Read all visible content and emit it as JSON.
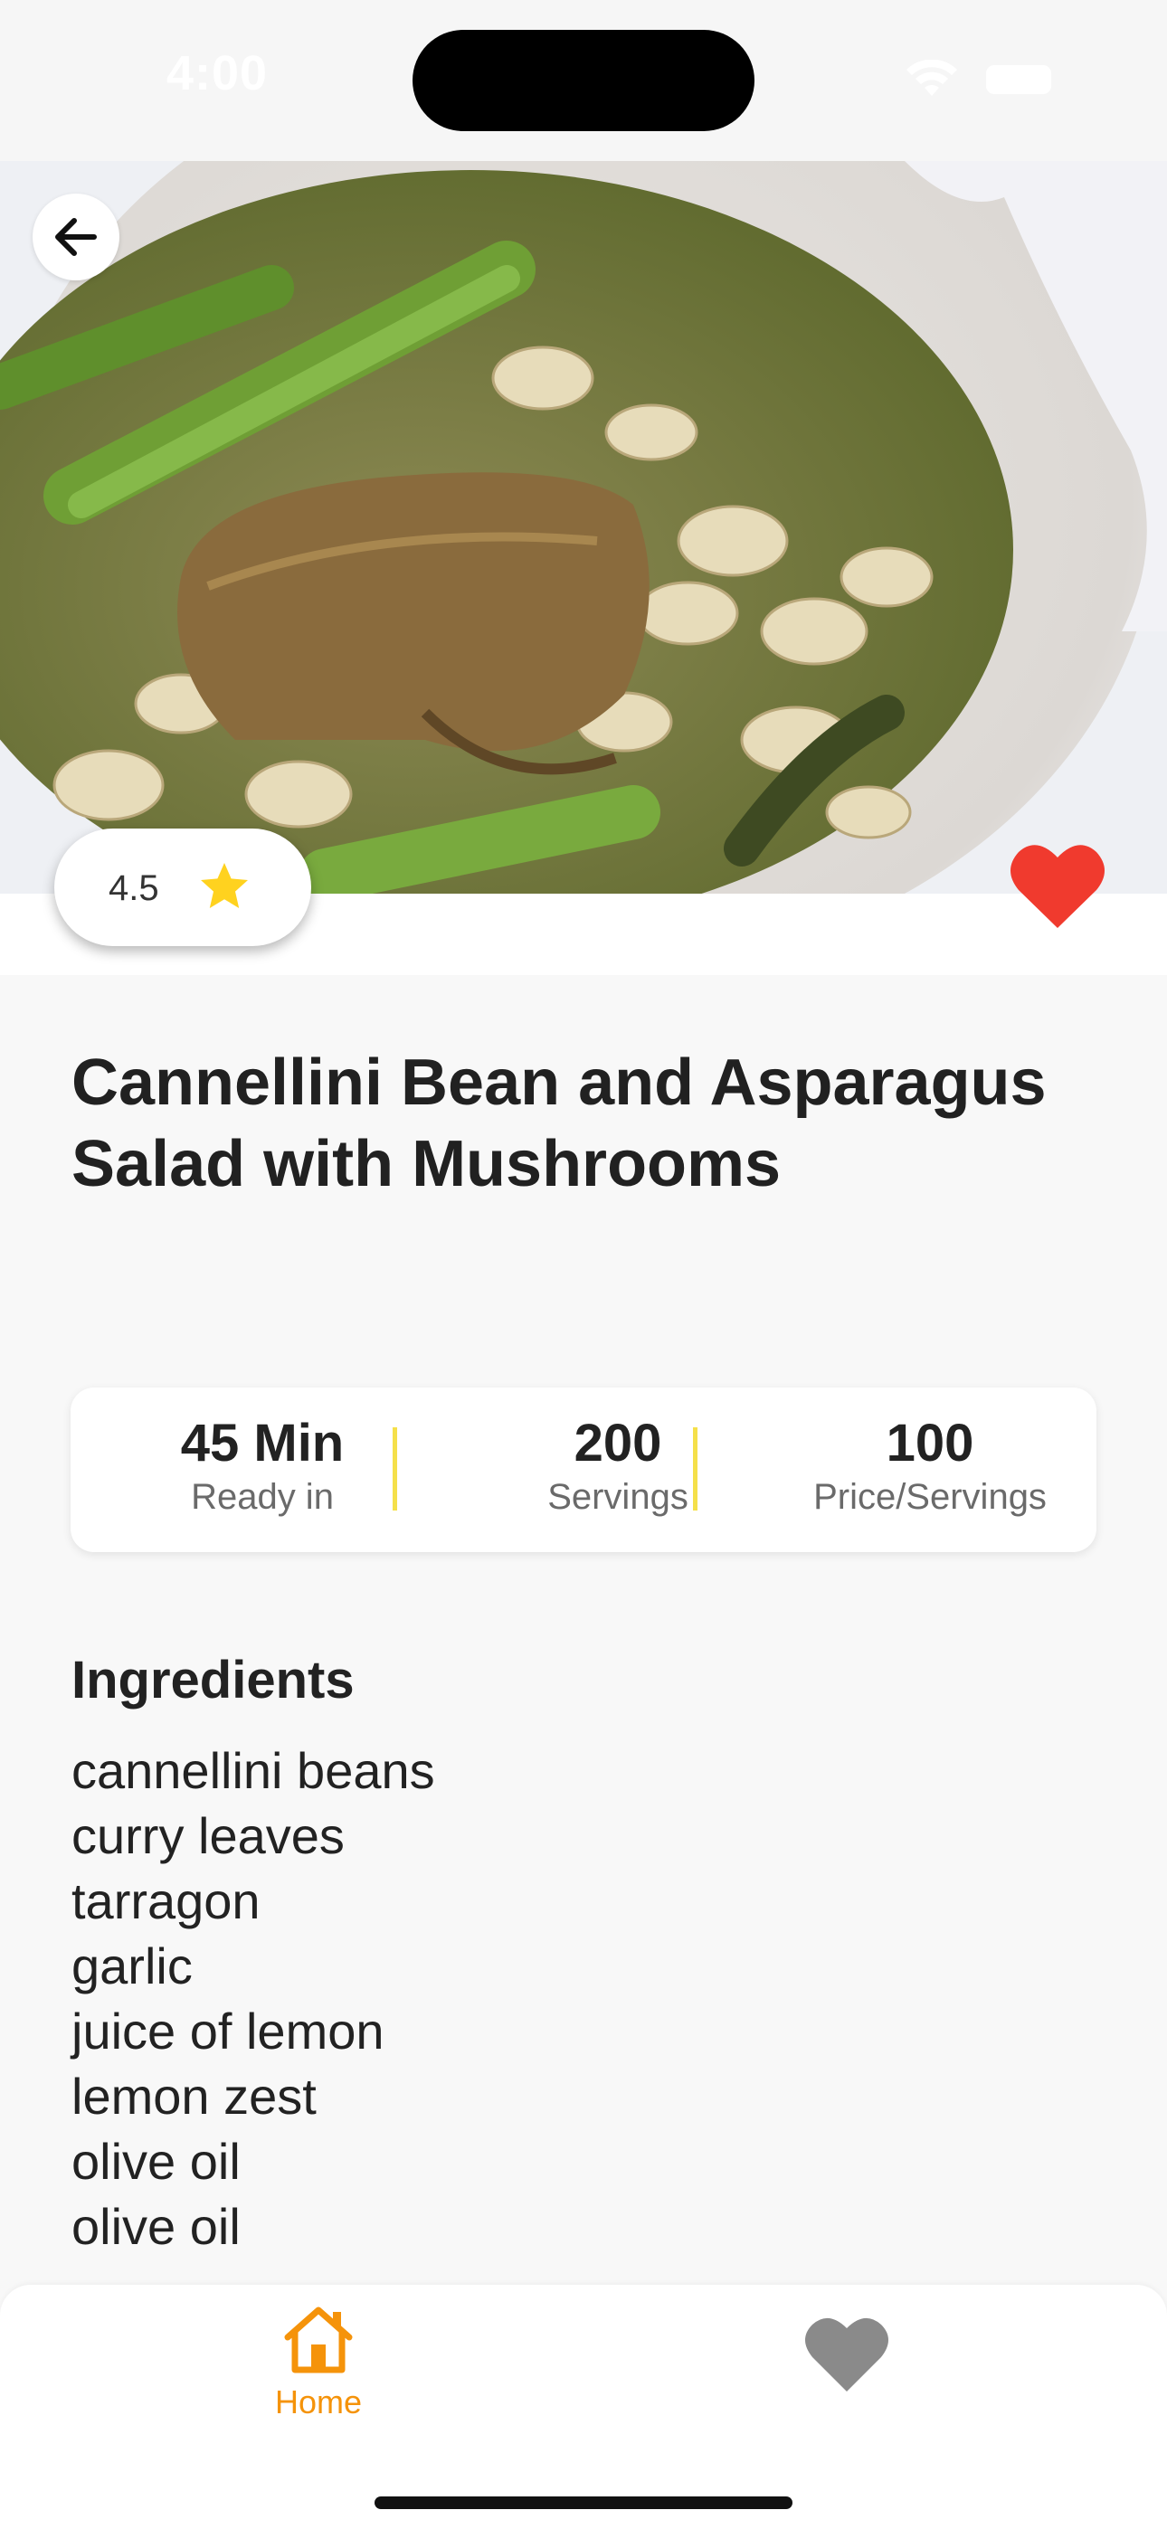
{
  "status_bar": {
    "time": "4:00"
  },
  "recipe": {
    "title": "Cannellini Bean and Asparagus Salad with Mushrooms",
    "rating": "4.5",
    "is_favorite": true
  },
  "stats": [
    {
      "value": "45 Min",
      "label": "Ready in"
    },
    {
      "value": "200",
      "label": "Servings"
    },
    {
      "value": "100",
      "label": "Price/Servings"
    }
  ],
  "ingredients": {
    "heading": "Ingredients",
    "items": [
      "cannellini beans",
      "curry leaves",
      "tarragon",
      "garlic",
      "juice of lemon",
      "lemon zest",
      "olive oil",
      "olive oil"
    ]
  },
  "tab_bar": {
    "home_label": "Home",
    "active": "home"
  },
  "colors": {
    "accent": "#f5930a",
    "heart": "#f03a2e",
    "star": "#ffd21f",
    "divider": "#f5e04a"
  },
  "icons": [
    "wifi-icon",
    "battery-icon",
    "arrow-left-icon",
    "star-icon",
    "heart-icon",
    "home-icon"
  ]
}
